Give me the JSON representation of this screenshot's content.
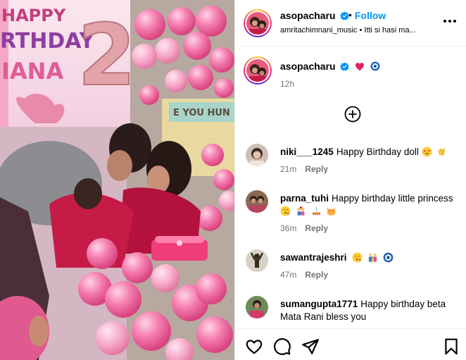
{
  "media": {
    "banner_line1": "HAPPY",
    "banner_line1b": "BIRTHDAY",
    "banner_line2": "RTHDAY",
    "banner_line3": "IANA",
    "balloon_number": "2",
    "wall_text": "E YOU HUN"
  },
  "header": {
    "username": "asopacharu",
    "separator": "•",
    "follow_label": "Follow",
    "audio_line": "amritachimnani_music • Itti si hasi ma..."
  },
  "caption": {
    "username": "asopacharu",
    "time": "12h"
  },
  "comments": [
    {
      "username": "niki___1245",
      "text": "Happy Birthday doll",
      "emojis": [
        "heart-eyes-emoji",
        "clap-emoji"
      ],
      "time": "21m",
      "reply_label": "Reply"
    },
    {
      "username": "parna_tuhi",
      "text": "Happy birthday little princess",
      "emojis": [
        "kiss-heart-emoji",
        "couple-emoji",
        "cake-emoji",
        "heart-eyes-cat-emoji"
      ],
      "time": "36m",
      "reply_label": "Reply"
    },
    {
      "username": "sawantrajeshri",
      "text": "",
      "emojis": [
        "kiss-heart-emoji",
        "family-emoji",
        "nazar-emoji"
      ],
      "time": "47m",
      "reply_label": "Reply"
    },
    {
      "username": "sumangupta1771",
      "text": "Happy birthday beta Mata Rani bless you",
      "emojis": [],
      "time": "",
      "reply_label": ""
    }
  ],
  "colors": {
    "follow_blue": "#0095f6",
    "verified_blue": "#0095f6",
    "muted_gray": "#737373",
    "heart_red": "#e0245e"
  },
  "icons": [
    "verified-badge-icon",
    "more-options-icon",
    "load-more-comments-icon",
    "like-heart-icon",
    "comment-icon",
    "share-icon",
    "save-bookmark-icon"
  ]
}
